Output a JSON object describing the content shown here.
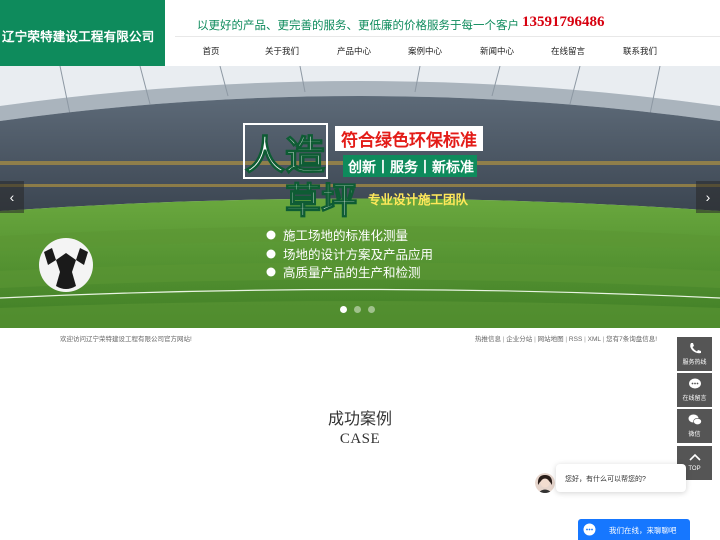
{
  "header": {
    "company_name": "辽宁荣特建设工程有限公司",
    "slogan": "以更好的产品、更完善的服务、更低廉的价格服务于每一个客户",
    "phone": "13591796486"
  },
  "nav": {
    "items": [
      "首页",
      "关于我们",
      "产品中心",
      "案例中心",
      "新闻中心",
      "在线留言",
      "联系我们"
    ]
  },
  "banner": {
    "headline_left": "人造",
    "headline_bottom": "草坪",
    "tagline": "符合绿色环保标准",
    "sub_tags": "创新丨服务丨新标准",
    "team_text": "专业设计施工团队",
    "bullets": [
      "施工场地的标准化测量",
      "场地的设计方案及产品应用",
      "高质量产品的生产和检测"
    ],
    "arrow_left": "‹",
    "arrow_right": "›",
    "slide_count": 3,
    "active_slide": 1
  },
  "infobar": {
    "welcome": "欢迎访问辽宁荣特建设工程有限公司官方网站!",
    "links": [
      "热推信息",
      "企业分站",
      "网站地图",
      "RSS",
      "XML",
      "您有7条询盘信息!"
    ],
    "separator": "|"
  },
  "case_section": {
    "title": "成功案例",
    "subtitle": "CASE"
  },
  "side_buttons": [
    {
      "label": "服务热线",
      "icon": "phone-icon"
    },
    {
      "label": "在线留言",
      "icon": "chat-icon"
    },
    {
      "label": "微信",
      "icon": "wechat-icon"
    },
    {
      "label": "TOP",
      "icon": "arrow-up-icon"
    }
  ],
  "chat": {
    "greeting": "您好，有什么可以帮您的?",
    "bar_label": "我们在线，来聊聊吧"
  },
  "colors": {
    "brand_green": "#0e8b5c",
    "phone_red": "#d7000f",
    "chat_blue": "#1677ff",
    "side_gray": "#555555"
  }
}
